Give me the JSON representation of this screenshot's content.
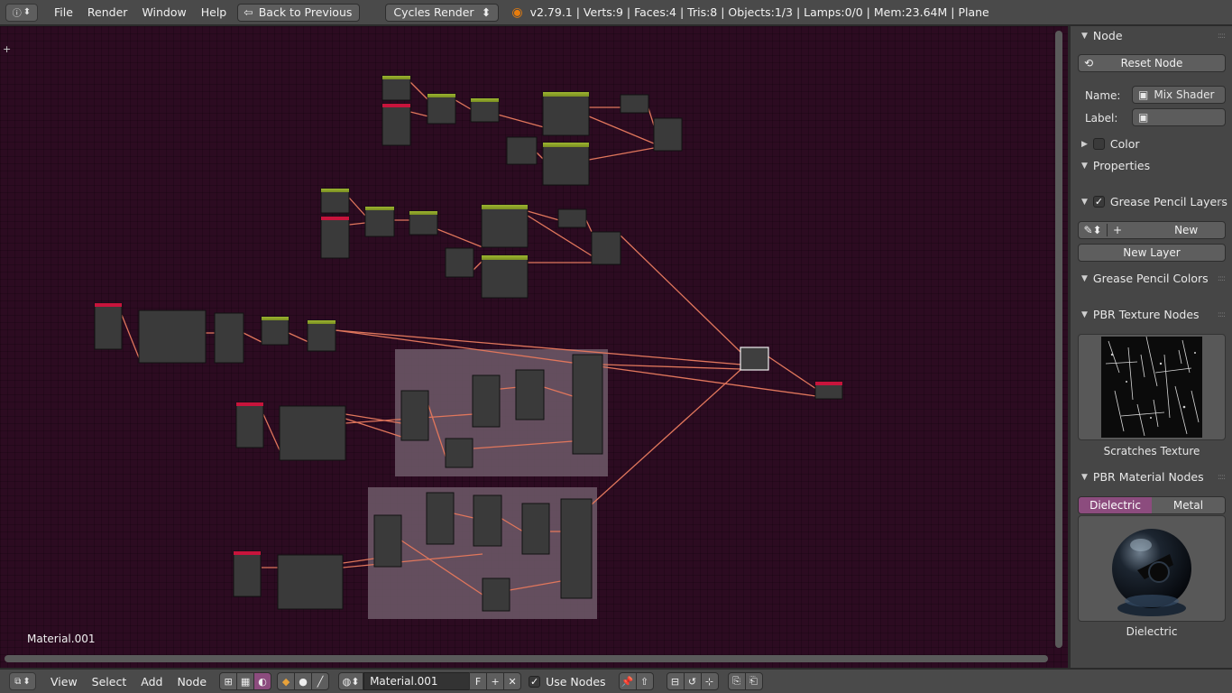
{
  "topbar": {
    "editor_icon": "info-icon",
    "menus": [
      "File",
      "Render",
      "Window",
      "Help"
    ],
    "back_label": "Back to Previous",
    "engine": "Cycles Render",
    "stats": "v2.79.1 | Verts:9 | Faces:4 | Tris:8 | Objects:1/3 | Lamps:0/0 | Mem:23.64M | Plane"
  },
  "editor": {
    "material_label": "Material.001",
    "wire_color": "#e0765c",
    "frame_color": "#6e5a68",
    "node_header_colors": {
      "input": "#8ca32a",
      "texture": "#c8143c",
      "shader": "#8ca32a",
      "output": "#c8143c"
    }
  },
  "panel": {
    "node_header": "Node",
    "reset_node": "Reset Node",
    "name_label": "Name:",
    "name_value": "Mix Shader",
    "label_label": "Label:",
    "label_value": "",
    "color_header": "Color",
    "properties_header": "Properties",
    "gp_layers_header": "Grease Pencil Layers",
    "new_label": "New",
    "new_layer_label": "New Layer",
    "gp_colors_header": "Grease Pencil Colors",
    "pbr_texture_header": "PBR Texture Nodes",
    "texture_caption": "Scratches Texture",
    "pbr_material_header": "PBR Material Nodes",
    "seg_dielectric": "Dielectric",
    "seg_metal": "Metal",
    "material_caption": "Dielectric",
    "accent": "#8c4c7e"
  },
  "bottombar": {
    "menus": [
      "View",
      "Select",
      "Add",
      "Node"
    ],
    "material": "Material.001",
    "fake_user": "F",
    "use_nodes": "Use Nodes"
  }
}
